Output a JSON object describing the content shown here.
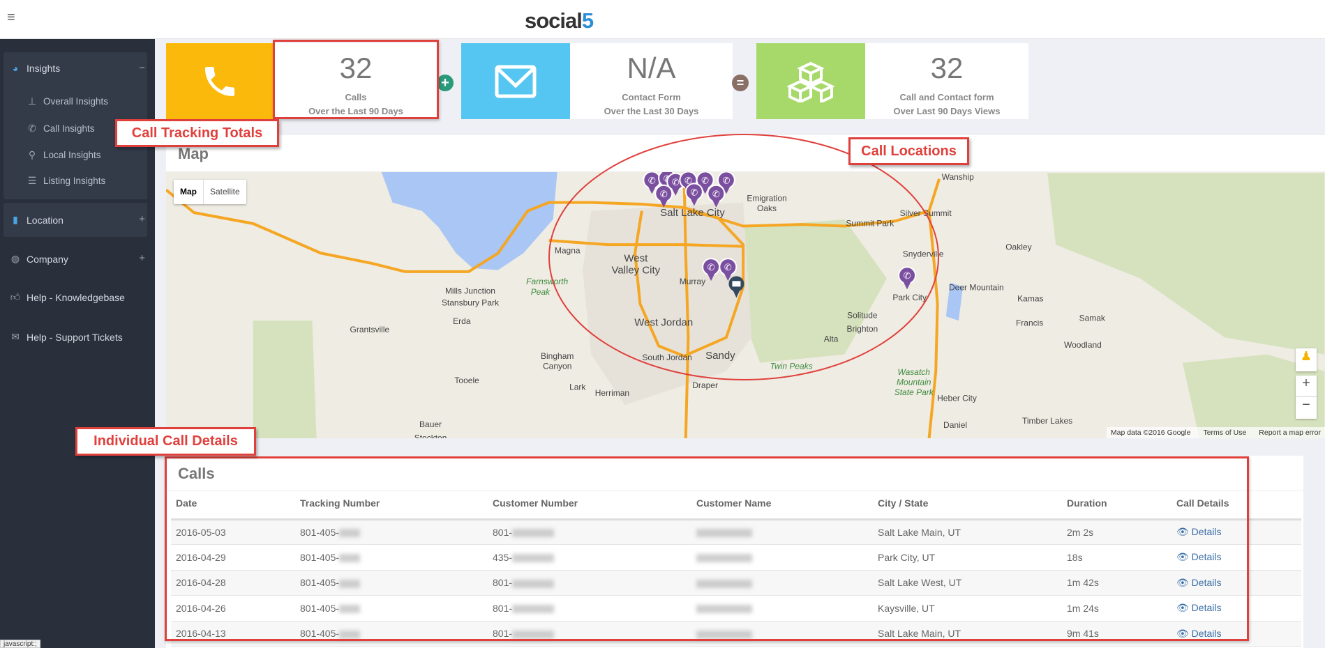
{
  "app": {
    "logo_prefix": "social",
    "logo_suffix": "5",
    "menu_icon": "hamburger-icon"
  },
  "sidebar": {
    "insights": {
      "label": "Insights",
      "toggle": "−",
      "icon": "dashboard-icon",
      "items": [
        {
          "label": "Overall Insights",
          "icon": "sitemap-icon"
        },
        {
          "label": "Call Insights",
          "icon": "phone-icon"
        },
        {
          "label": "Local Insights",
          "icon": "map-marker-icon"
        },
        {
          "label": "Listing Insights",
          "icon": "list-icon"
        }
      ]
    },
    "location": {
      "label": "Location",
      "toggle": "+",
      "icon": "building-icon"
    },
    "company": {
      "label": "Company",
      "toggle": "+",
      "icon": "globe-icon"
    },
    "help_kb": {
      "label": "Help - Knowledgebase",
      "icon": "thumbs-up-icon"
    },
    "help_tickets": {
      "label": "Help - Support Tickets",
      "icon": "envelope-icon"
    }
  },
  "stats": [
    {
      "value": "32",
      "label": "Calls",
      "period": "Over the Last 90 Days",
      "icon": "phone-icon",
      "color": "#fbb90c"
    },
    {
      "value": "N/A",
      "label": "Contact Form",
      "period": "Over the Last 30 Days",
      "icon": "envelope-icon",
      "color": "#55c6f2"
    },
    {
      "value": "32",
      "label": "Call and Contact form",
      "period": "Over Last 90 Days Views",
      "icon": "cubes-icon",
      "color": "#a6d96a"
    }
  ],
  "operators": {
    "plus": "+",
    "equals": "="
  },
  "map": {
    "title": "Map",
    "type_map": "Map",
    "type_satellite": "Satellite",
    "zoom_in": "+",
    "zoom_out": "−",
    "footer": {
      "data": "Map data ©2016 Google",
      "terms": "Terms of Use",
      "report": "Report a map error"
    },
    "labels": [
      "Salt Lake City",
      "West",
      "Valley City",
      "Magna",
      "Murray",
      "West Jordan",
      "Sandy",
      "South Jordan",
      "Draper",
      "Herriman",
      "Bingham",
      "Canyon",
      "Lark",
      "Tooele",
      "Erda",
      "Grantsville",
      "Mills Junction",
      "Stansbury Park",
      "Farnsworth",
      "Peak",
      "Emigration",
      "Oaks",
      "Summit Park",
      "Silver Summit",
      "Wanship",
      "Snyderville",
      "Oakley",
      "Park City",
      "Deer Mountain",
      "Kamas",
      "Francis",
      "Samak",
      "Woodland",
      "Solitude",
      "Brighton",
      "Alta",
      "Twin Peaks",
      "Wasatch",
      "Mountain",
      "State Park",
      "Heber City",
      "Daniel",
      "Timber Lakes",
      "Bauer",
      "Stockton"
    ],
    "marker_color": "#7b4fa0"
  },
  "calls": {
    "title": "Calls",
    "columns": [
      "Date",
      "Tracking Number",
      "Customer Number",
      "Customer Name",
      "City / State",
      "Duration",
      "Call Details"
    ],
    "rows": [
      {
        "date": "2016-05-03",
        "tracking": "801-405-",
        "customer": "801-",
        "city": "Salt Lake Main, UT",
        "duration": "2m 2s",
        "details": "Details"
      },
      {
        "date": "2016-04-29",
        "tracking": "801-405-",
        "customer": "435-",
        "city": "Park City, UT",
        "duration": "18s",
        "details": "Details"
      },
      {
        "date": "2016-04-28",
        "tracking": "801-405-",
        "customer": "801-",
        "city": "Salt Lake West, UT",
        "duration": "1m 42s",
        "details": "Details"
      },
      {
        "date": "2016-04-26",
        "tracking": "801-405-",
        "customer": "801-",
        "city": "Kaysville, UT",
        "duration": "1m 24s",
        "details": "Details"
      },
      {
        "date": "2016-04-13",
        "tracking": "801-405-",
        "customer": "801-",
        "city": "Salt Lake Main, UT",
        "duration": "9m 41s",
        "details": "Details"
      }
    ]
  },
  "annotations": {
    "totals": "Call Tracking Totals",
    "locations": "Call Locations",
    "details": "Individual Call Details",
    "accent": "#e0403c"
  },
  "status_bar": "javascript:;"
}
